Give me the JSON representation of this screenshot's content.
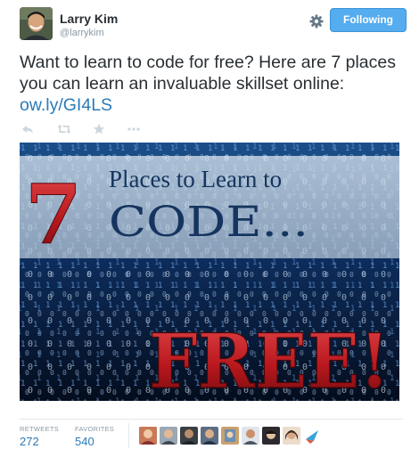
{
  "author": {
    "name": "Larry Kim",
    "handle": "@larrykim"
  },
  "follow_button": {
    "label": "Following"
  },
  "tweet": {
    "text": "Want to learn to code for free? Here are 7 places you can learn an invaluable skillset online:",
    "link": "ow.ly/GI4LS"
  },
  "actions": [
    "reply-icon",
    "retweet-icon",
    "favorite-icon",
    "more-icon"
  ],
  "media": {
    "number": "7",
    "line1": "Places to Learn to",
    "line2": "CODE...",
    "line3": "FREE!"
  },
  "stats": {
    "retweets_label": "RETWEETS",
    "retweets_value": "272",
    "favorites_label": "FAVORITES",
    "favorites_value": "540"
  },
  "favoriter_avatars": [
    "avatar-1",
    "avatar-2",
    "avatar-3",
    "avatar-4",
    "avatar-5",
    "avatar-6",
    "avatar-7",
    "avatar-8",
    "avatar-9",
    "avatar-10"
  ],
  "colors": {
    "accent": "#55acee",
    "link": "#2b7bb9",
    "text": "#292f33",
    "muted": "#8899a6"
  }
}
